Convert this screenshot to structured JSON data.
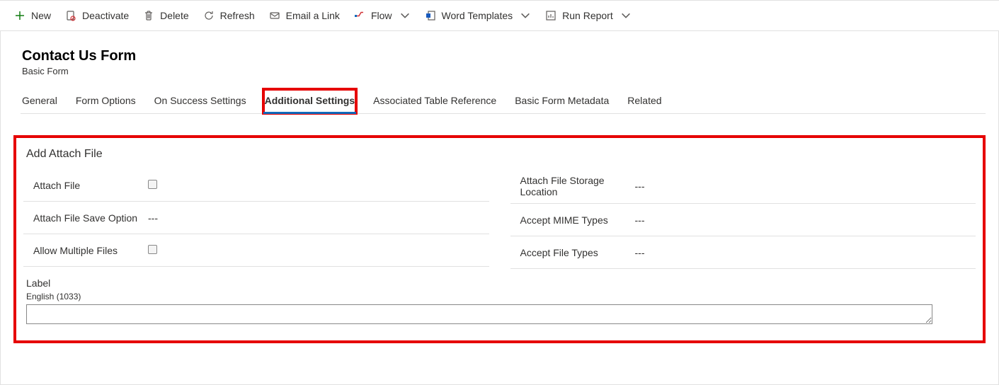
{
  "commandBar": {
    "new": "New",
    "deactivate": "Deactivate",
    "delete": "Delete",
    "refresh": "Refresh",
    "emailLink": "Email a Link",
    "flow": "Flow",
    "wordTemplates": "Word Templates",
    "runReport": "Run Report"
  },
  "header": {
    "title": "Contact Us Form",
    "subtitle": "Basic Form"
  },
  "tabs": {
    "general": "General",
    "formOptions": "Form Options",
    "onSuccess": "On Success Settings",
    "additional": "Additional Settings",
    "assocRef": "Associated Table Reference",
    "metadata": "Basic Form Metadata",
    "related": "Related"
  },
  "section": {
    "title": "Add Attach File",
    "left": {
      "attachFileLabel": "Attach File",
      "saveOptionLabel": "Attach File Save Option",
      "saveOptionValue": "---",
      "allowMultipleLabel": "Allow Multiple Files"
    },
    "right": {
      "storageLabel": "Attach File Storage Location",
      "storageValue": "---",
      "mimeLabel": "Accept MIME Types",
      "mimeValue": "---",
      "fileTypesLabel": "Accept File Types",
      "fileTypesValue": "---"
    },
    "labelField": {
      "title": "Label",
      "lang": "English (1033)",
      "value": ""
    }
  }
}
